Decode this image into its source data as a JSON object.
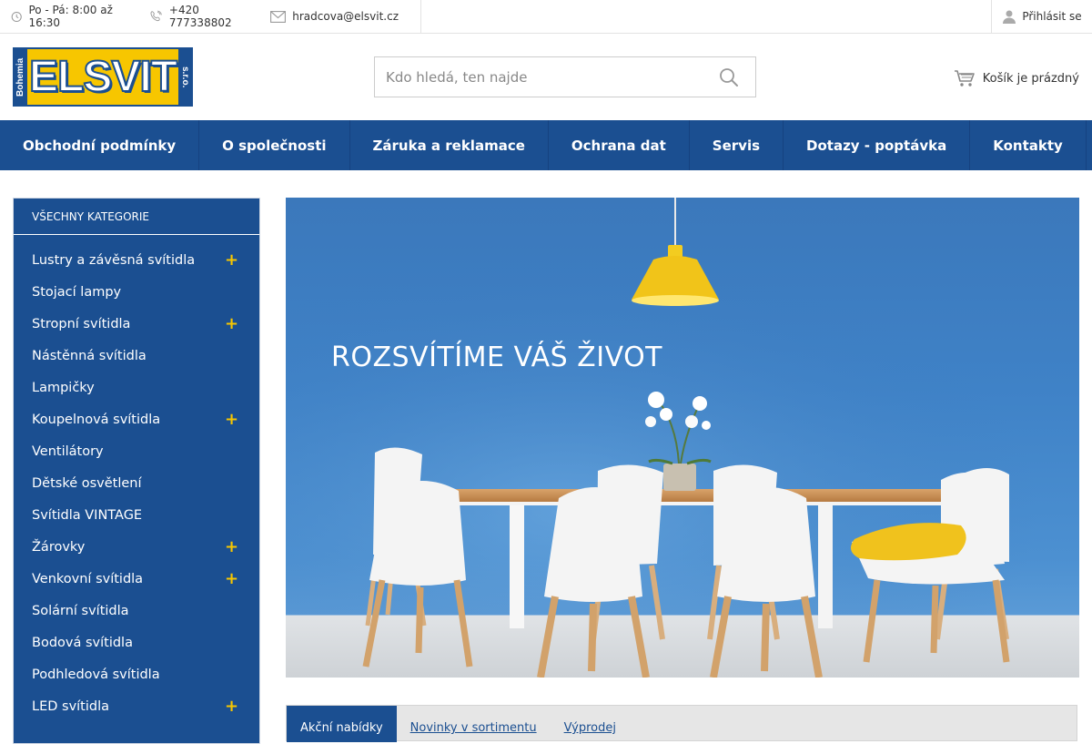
{
  "topbar": {
    "hours": "Po - Pá: 8:00 až 16:30",
    "phone": "+420 777338802",
    "email": "hradcova@elsvit.cz",
    "login": "Přihlásit se"
  },
  "logo": {
    "main": "ELSVIT",
    "left": "Bohemia",
    "right": "s.r.o."
  },
  "search": {
    "placeholder": "Kdo hledá, ten najde"
  },
  "cart": {
    "label": "Košík je prázdný"
  },
  "nav": [
    "Obchodní podmínky",
    "O společnosti",
    "Záruka a reklamace",
    "Ochrana dat",
    "Servis",
    "Dotazy - poptávka",
    "Kontakty"
  ],
  "sidebar": {
    "heading": "VŠECHNY KATEGORIE",
    "items": [
      {
        "label": "Lustry a závěsná svítidla",
        "expandable": true
      },
      {
        "label": "Stojací lampy",
        "expandable": false
      },
      {
        "label": "Stropní svítidla",
        "expandable": true
      },
      {
        "label": "Nástěnná svítidla",
        "expandable": false
      },
      {
        "label": "Lampičky",
        "expandable": false
      },
      {
        "label": "Koupelnová svítidla",
        "expandable": true
      },
      {
        "label": "Ventilátory",
        "expandable": false
      },
      {
        "label": "Dětské osvětlení",
        "expandable": false
      },
      {
        "label": "Svítidla VINTAGE",
        "expandable": false
      },
      {
        "label": "Žárovky",
        "expandable": true
      },
      {
        "label": "Venkovní svítidla",
        "expandable": true
      },
      {
        "label": "Solární svítidla",
        "expandable": false
      },
      {
        "label": "Bodová svítidla",
        "expandable": false
      },
      {
        "label": "Podhledová svítidla",
        "expandable": false
      },
      {
        "label": "LED svítidla",
        "expandable": true
      }
    ],
    "expand_symbol": "+"
  },
  "banner": {
    "heading": "ROZSVÍTÍME VÁŠ ŽIVOT"
  },
  "tabs": [
    "Akční nabídky",
    "Novinky v sortimentu",
    "Výprodej"
  ],
  "colors": {
    "brand_blue": "#1b4f91",
    "accent_yellow": "#f7c600"
  }
}
